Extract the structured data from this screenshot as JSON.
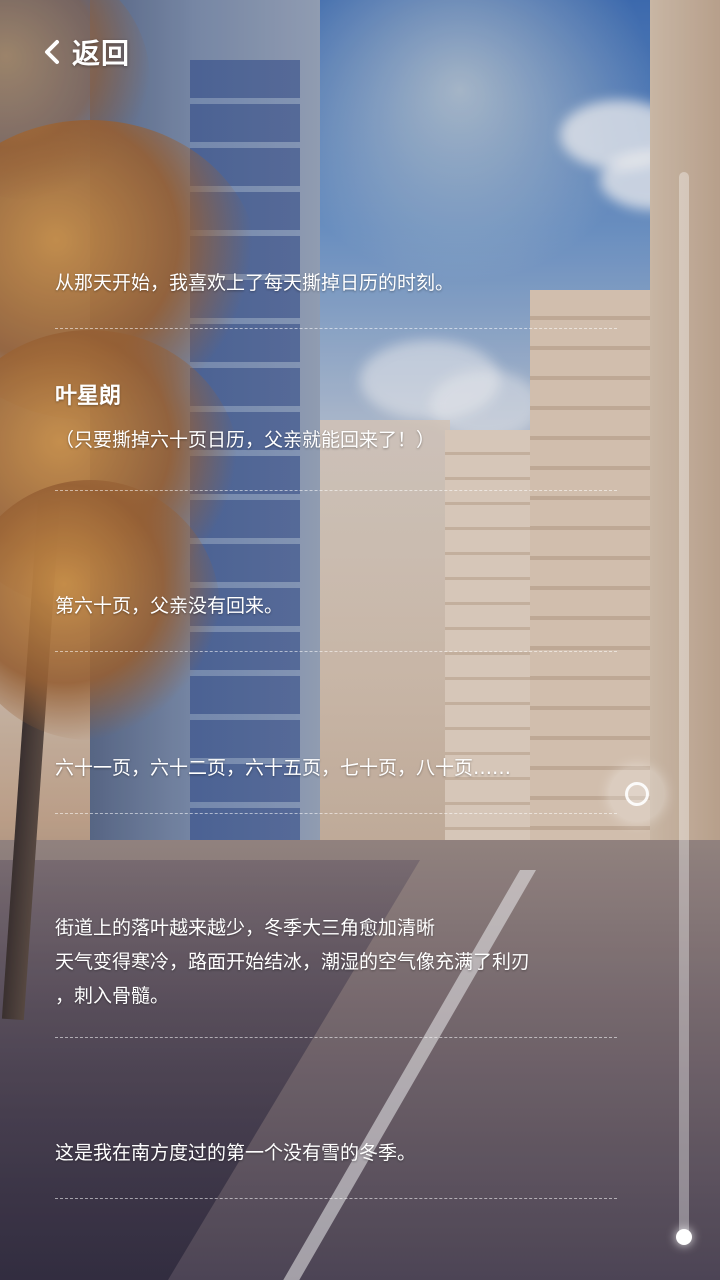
{
  "header": {
    "back_label": "返回",
    "back_icon": "chevron-left-icon"
  },
  "entries": [
    {
      "lines": [
        "从那天开始，我喜欢上了每天撕掉日历的时刻。"
      ]
    },
    {
      "speaker": "叶星朗",
      "lines": [
        "（只要撕掉六十页日历，父亲就能回来了！）"
      ]
    },
    {
      "lines": [
        "第六十页，父亲没有回来。"
      ]
    },
    {
      "lines": [
        "六十一页，六十二页，六十五页，七十页，八十页……"
      ]
    },
    {
      "lines": [
        "街道上的落叶越来越少，冬季大三角愈加清晰",
        "天气变得寒冷，路面开始结冰，潮湿的空气像充满了利刃",
        "，刺入骨髓。"
      ]
    },
    {
      "lines": [
        "这是我在南方度过的第一个没有雪的冬季。"
      ]
    }
  ],
  "scroll": {
    "position": 0.58
  },
  "colors": {
    "text": "#ffffff",
    "divider": "#ffffff",
    "track": "#ffffff"
  }
}
